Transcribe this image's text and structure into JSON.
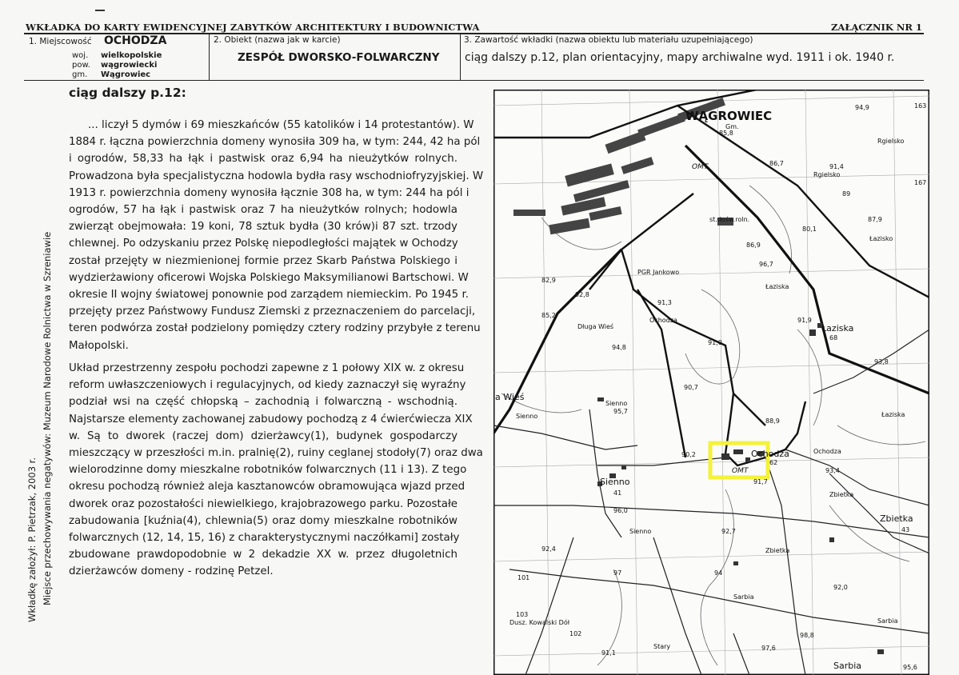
{
  "header": {
    "title": "WKŁADKA DO KARTY EWIDENCYJNEJ ZABYTKÓW ARCHITEKTURY I BUDOWNICTWA",
    "annex": "ZAŁĄCZNIK NR 1"
  },
  "field1": {
    "label": "1. Miejscowość",
    "value": "OCHODZA",
    "woj_label": "woj.",
    "woj_value": "wielkopolskie",
    "pow_label": "pow.",
    "pow_value": "wągrowiecki",
    "gm_label": "gm.",
    "gm_value": "Wągrowiec"
  },
  "field2": {
    "label": "2. Obiekt (nazwa jak w karcie)",
    "value": "ZESPÓŁ DWORSKO-FOLWARCZNY"
  },
  "field3": {
    "label": "3. Zawartość wkładki (nazwa obiektu lub materiału uzupełniającego)",
    "value": "ciąg dalszy p.12, plan orientacyjny, mapy archiwalne wyd. 1911 i ok. 1940 r."
  },
  "sidebar": {
    "author": "Wkładkę założył: P. Pietrzak, 2003 r.",
    "negatives": "Miejsce przechowywania negatywów: Muzeum Narodowe Rolnictwa w Szreniawie"
  },
  "section_title": "ciąg dalszy p.12:",
  "paragraph1": [
    "... liczył 5 dymów i 69 mieszkańców (55 katolików i 14 protestantów). W",
    "1884 r. łączna powierzchnia domeny wynosiła 309 ha, w tym: 244, 42 ha pól",
    "i ogrodów, 58,33 ha łąk i pastwisk oraz 6,94 ha nieużytków rolnych.",
    "Prowadzona była specjalistyczna hodowla bydła rasy wschodniofryzyjskiej. W",
    "1913 r. powierzchnia domeny wynosiła łącznie 308 ha, w tym: 244 ha pól i",
    "ogrodów, 57 ha łąk i pastwisk oraz 7 ha nieużytków rolnych; hodowla",
    "zwierząt obejmowała: 19 koni, 78 sztuk bydła (30 krów)i 87 szt. trzody",
    "chlewnej. Po odzyskaniu przez Polskę niepodległości majątek w Ochodzy",
    "został przejęty w niezmienionej formie przez Skarb Państwa Polskiego i",
    "wydzierżawiony oficerowi Wojska Polskiego Maksymilianowi Bartschowi. W",
    "okresie II wojny światowej ponownie pod zarządem niemieckim. Po 1945 r.",
    "przejęty przez Państwowy Fundusz Ziemski z przeznaczeniem do parcelacji,",
    "teren podwórza został podzielony pomiędzy cztery rodziny przybyłe z terenu",
    "Małopolski."
  ],
  "paragraph2": [
    "Układ przestrzenny zespołu pochodzi zapewne z 1 połowy XIX w. z okresu",
    "reform uwłaszczeniowych i regulacyjnych, od kiedy zaznaczył się wyraźny",
    "podział wsi na część chłopską – zachodnią i folwarczną - wschodnią.",
    "Najstarsze elementy zachowanej zabudowy pochodzą z 4 ćwierćwiecza XIX",
    "w. Są to dworek (raczej dom) dzierżawcy(1), budynek gospodarczy",
    "mieszczący w przeszłości m.in. pralnię(2), ruiny ceglanej stodoły(7) oraz dwa",
    "wielorodzinne domy mieszkalne robotników folwarcznych (11 i 13). Z tego",
    "okresu pochodzą również aleja kasztanowców obramowująca wjazd przed",
    "dworek oraz pozostałości niewielkiego, krajobrazowego parku. Pozostałe",
    "zabudowania [kuźnia(4), chlewnia(5) oraz domy mieszkalne robotników",
    "folwarcznych (12, 14, 15, 16) z charakterystycznymi naczółkami] zostały",
    "zbudowane prawdopodobnie w 2 dekadzie XX w. przez długoletnich",
    "dzierżawców domeny - rodzinę Petzel."
  ],
  "map": {
    "labels": {
      "wagrowiec": "WĄGROWIEC",
      "gm": "Gm.",
      "rgielsko1": "Rgielsko",
      "rgielsko2": "Rgielsko",
      "omt1": "OMT",
      "stdosw": "st.dośw.roln.",
      "lazisko1": "Łazisko",
      "lazisko2": "Łaziska",
      "lazisko3": "Łaziska",
      "lazisko4": "Łaziska",
      "pgr": "PGR Jankowo",
      "dlugawies": "Długa Wieś",
      "ochodza_small": "Ochodza",
      "wies": "a Wieś",
      "sienno1": "Sienno",
      "sienno2": "Sienno",
      "sienno3": "Sienno",
      "sienno4": "Sienno",
      "ochodza_main": "Ochodza",
      "ochodza_right": "Ochodza",
      "omt2": "OMT",
      "zbietka1": "Zbietka",
      "zbietka2": "Zbietka",
      "zbietka3": "Zbietka",
      "sarbia1": "Sarbia",
      "sarbia2": "Sarbia",
      "sarbia3": "Sarbia",
      "stary": "Stary",
      "dusz": "Dusz. Kowalski Dół",
      "n62": "62",
      "n41": "41",
      "n43": "43",
      "n68": "68",
      "e949": "94,9",
      "e858": "85,8",
      "e867": "86,7",
      "e914": "91,4",
      "e89": "89",
      "e879": "87,9",
      "e801": "80,1",
      "e869": "86,9",
      "e967": "96,7",
      "e829": "82,9",
      "e928": "92,8",
      "e913": "91,3",
      "e852": "85,2",
      "e948": "94,8",
      "e910": "91,0",
      "e919": "91,9",
      "e938": "93,8",
      "e907": "90,7",
      "e957": "95,7",
      "e889": "88,9",
      "e902": "90,2",
      "e917": "91,7",
      "e934": "93,4",
      "e960": "96,0",
      "e927": "92,7",
      "e924": "92,4",
      "e920": "92,0",
      "e976": "97,6",
      "e988": "98,8",
      "e911": "91,1",
      "e956": "95,6",
      "r163": "163",
      "r167": "167",
      "r101": "101",
      "r103": "103",
      "r102": "102",
      "r94": "94",
      "r97": "97"
    }
  },
  "colors": {
    "highlight": "#f4f23a",
    "ink": "#1a1a1a",
    "paper": "#f7f7f5"
  }
}
